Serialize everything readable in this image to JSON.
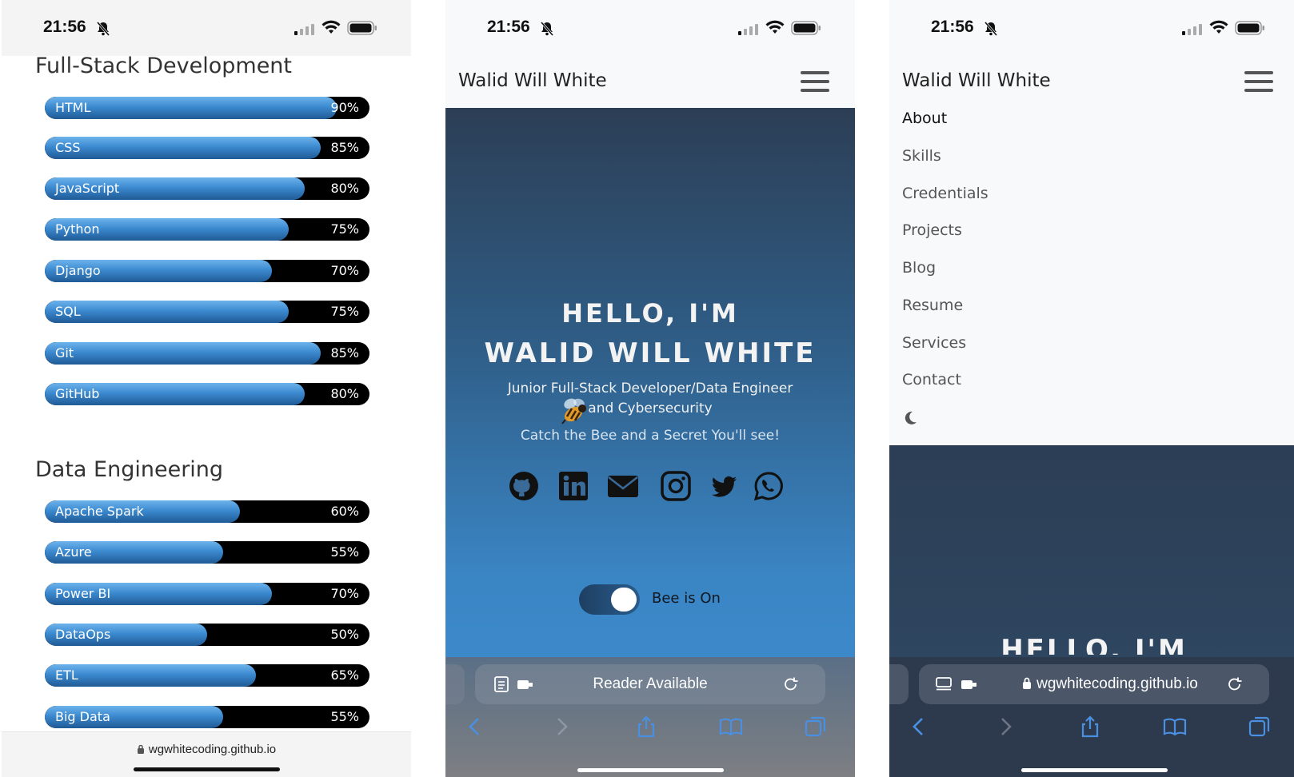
{
  "status": {
    "time": "21:56"
  },
  "panel1": {
    "sections": [
      {
        "title": "Full-Stack Development",
        "skills": [
          {
            "name": "HTML",
            "percent": 90,
            "label": "90%"
          },
          {
            "name": "CSS",
            "percent": 85,
            "label": "85%"
          },
          {
            "name": "JavaScript",
            "percent": 80,
            "label": "80%"
          },
          {
            "name": "Python",
            "percent": 75,
            "label": "75%"
          },
          {
            "name": "Django",
            "percent": 70,
            "label": "70%"
          },
          {
            "name": "SQL",
            "percent": 75,
            "label": "75%"
          },
          {
            "name": "Git",
            "percent": 85,
            "label": "85%"
          },
          {
            "name": "GitHub",
            "percent": 80,
            "label": "80%"
          }
        ]
      },
      {
        "title": "Data Engineering",
        "skills": [
          {
            "name": "Apache Spark",
            "percent": 60,
            "label": "60%"
          },
          {
            "name": "Azure",
            "percent": 55,
            "label": "55%"
          },
          {
            "name": "Power BI",
            "percent": 70,
            "label": "70%"
          },
          {
            "name": "DataOps",
            "percent": 50,
            "label": "50%"
          },
          {
            "name": "ETL",
            "percent": 65,
            "label": "65%"
          },
          {
            "name": "Big Data",
            "percent": 55,
            "label": "55%"
          }
        ]
      }
    ],
    "url": "wgwhitecoding.github.io"
  },
  "navbar": {
    "brand": "Walid Will White"
  },
  "hero": {
    "line1": "HELLO, I'M",
    "line2": "WALID WILL WHITE",
    "subtitle_line1": "Junior Full-Stack Developer/Data Engineer",
    "subtitle_line2": "and Cybersecurity",
    "tagline": "Catch the Bee and a Secret You'll see!",
    "socials": [
      "github-icon",
      "linkedin-icon",
      "email-icon",
      "instagram-icon",
      "twitter-icon",
      "whatsapp-icon"
    ],
    "toggle_label": "Bee is On",
    "toggle_on": true
  },
  "safari": {
    "panel2_address": "Reader Available",
    "panel3_address": "wgwhitecoding.github.io"
  },
  "menu": {
    "items": [
      "About",
      "Skills",
      "Credentials",
      "Projects",
      "Blog",
      "Resume",
      "Services",
      "Contact"
    ],
    "active": "About",
    "theme_icon": "moon-icon"
  },
  "panel3_hero_peek": "HELLO, I'M",
  "colors": {
    "accent": "#3c8ad0",
    "bar_bg": "#000000",
    "hero_top": "#2c3e55",
    "hero_bottom": "#3f8fd2",
    "safari_link": "#4a90e2"
  }
}
